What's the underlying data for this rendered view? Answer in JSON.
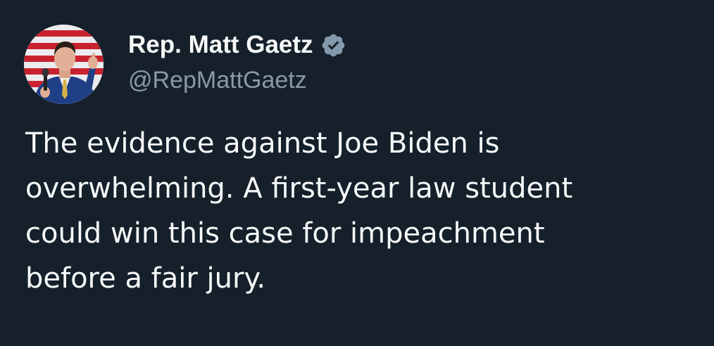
{
  "colors": {
    "background": "#15202b",
    "text_primary": "#f7f9f9",
    "text_secondary": "#8b98a5",
    "verified_badge": "#829aab"
  },
  "author": {
    "display_name": "Rep. Matt Gaetz",
    "handle": "@RepMattGaetz",
    "verified_icon": "verified-badge-icon",
    "avatar_icon": "profile-photo"
  },
  "tweet": {
    "lines": [
      "The evidence against Joe Biden is",
      "overwhelming. A first-year law student",
      "could win this case for impeachment",
      "before a fair jury."
    ]
  }
}
